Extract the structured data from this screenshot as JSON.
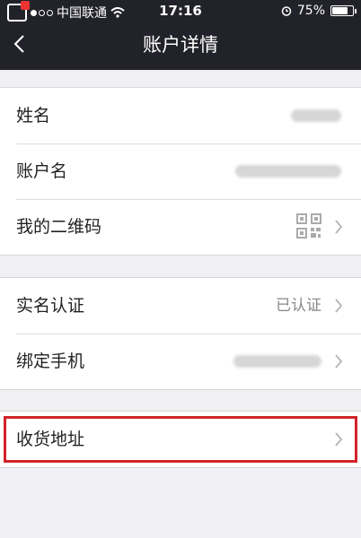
{
  "status_bar": {
    "carrier": "中国联通",
    "time": "17:16",
    "battery_percent": "75%",
    "battery_level": 0.75
  },
  "nav": {
    "title": "账户详情"
  },
  "groups": [
    {
      "rows": [
        {
          "label": "姓名",
          "value": "",
          "blurred": true
        },
        {
          "label": "账户名",
          "value": "",
          "blurred": true
        },
        {
          "label": "我的二维码",
          "icon": "qr-code-icon",
          "chevron": true
        }
      ]
    },
    {
      "rows": [
        {
          "label": "实名认证",
          "value": "已认证",
          "chevron": true
        },
        {
          "label": "绑定手机",
          "value": "",
          "blurred": true,
          "chevron": true
        }
      ]
    },
    {
      "rows": [
        {
          "label": "收货地址",
          "chevron": true
        }
      ]
    }
  ],
  "colors": {
    "header_bg": "#22232a",
    "page_bg": "#efeff4",
    "highlight": "#d2232a"
  }
}
